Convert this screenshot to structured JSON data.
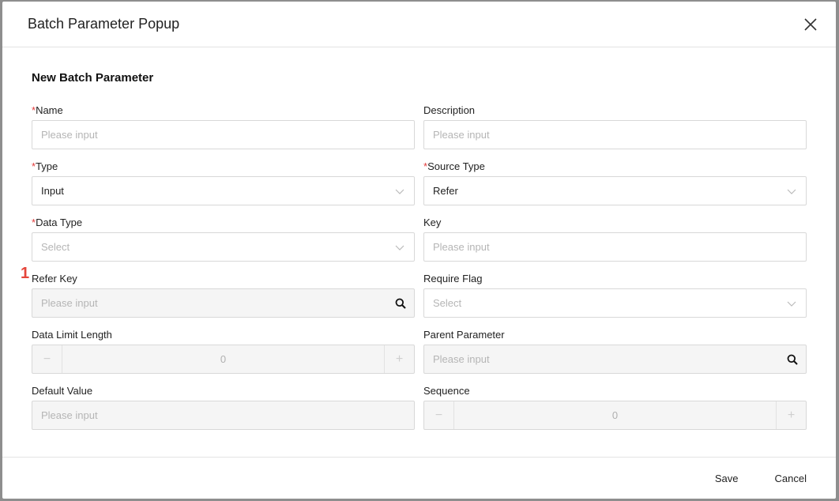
{
  "modal": {
    "title": "Batch Parameter Popup",
    "section_title": "New Batch Parameter",
    "marker": "1"
  },
  "fields": {
    "name": {
      "label": "Name",
      "required": "*",
      "placeholder": "Please input"
    },
    "description": {
      "label": "Description",
      "placeholder": "Please input"
    },
    "type": {
      "label": "Type",
      "required": "*",
      "value": "Input"
    },
    "source_type": {
      "label": "Source Type",
      "required": "*",
      "value": "Refer"
    },
    "data_type": {
      "label": "Data Type",
      "required": "*",
      "placeholder": "Select"
    },
    "key": {
      "label": "Key",
      "placeholder": "Please input"
    },
    "refer_key": {
      "label": "Refer Key",
      "placeholder": "Please input"
    },
    "require_flag": {
      "label": "Require Flag",
      "placeholder": "Select"
    },
    "data_limit_length": {
      "label": "Data Limit Length",
      "value": "0",
      "minus": "−",
      "plus": "+"
    },
    "parent_parameter": {
      "label": "Parent Parameter",
      "placeholder": "Please input"
    },
    "default_value": {
      "label": "Default Value",
      "placeholder": "Please input"
    },
    "sequence": {
      "label": "Sequence",
      "value": "0",
      "minus": "−",
      "plus": "+"
    }
  },
  "footer": {
    "save_label": "Save",
    "cancel_label": "Cancel"
  },
  "icons": {
    "close": "close-icon",
    "chevron": "chevron-down-icon",
    "search": "search-icon"
  },
  "colors": {
    "required": "#e23b3b",
    "marker": "#e5453a",
    "disabled_bg": "#f5f5f5"
  }
}
